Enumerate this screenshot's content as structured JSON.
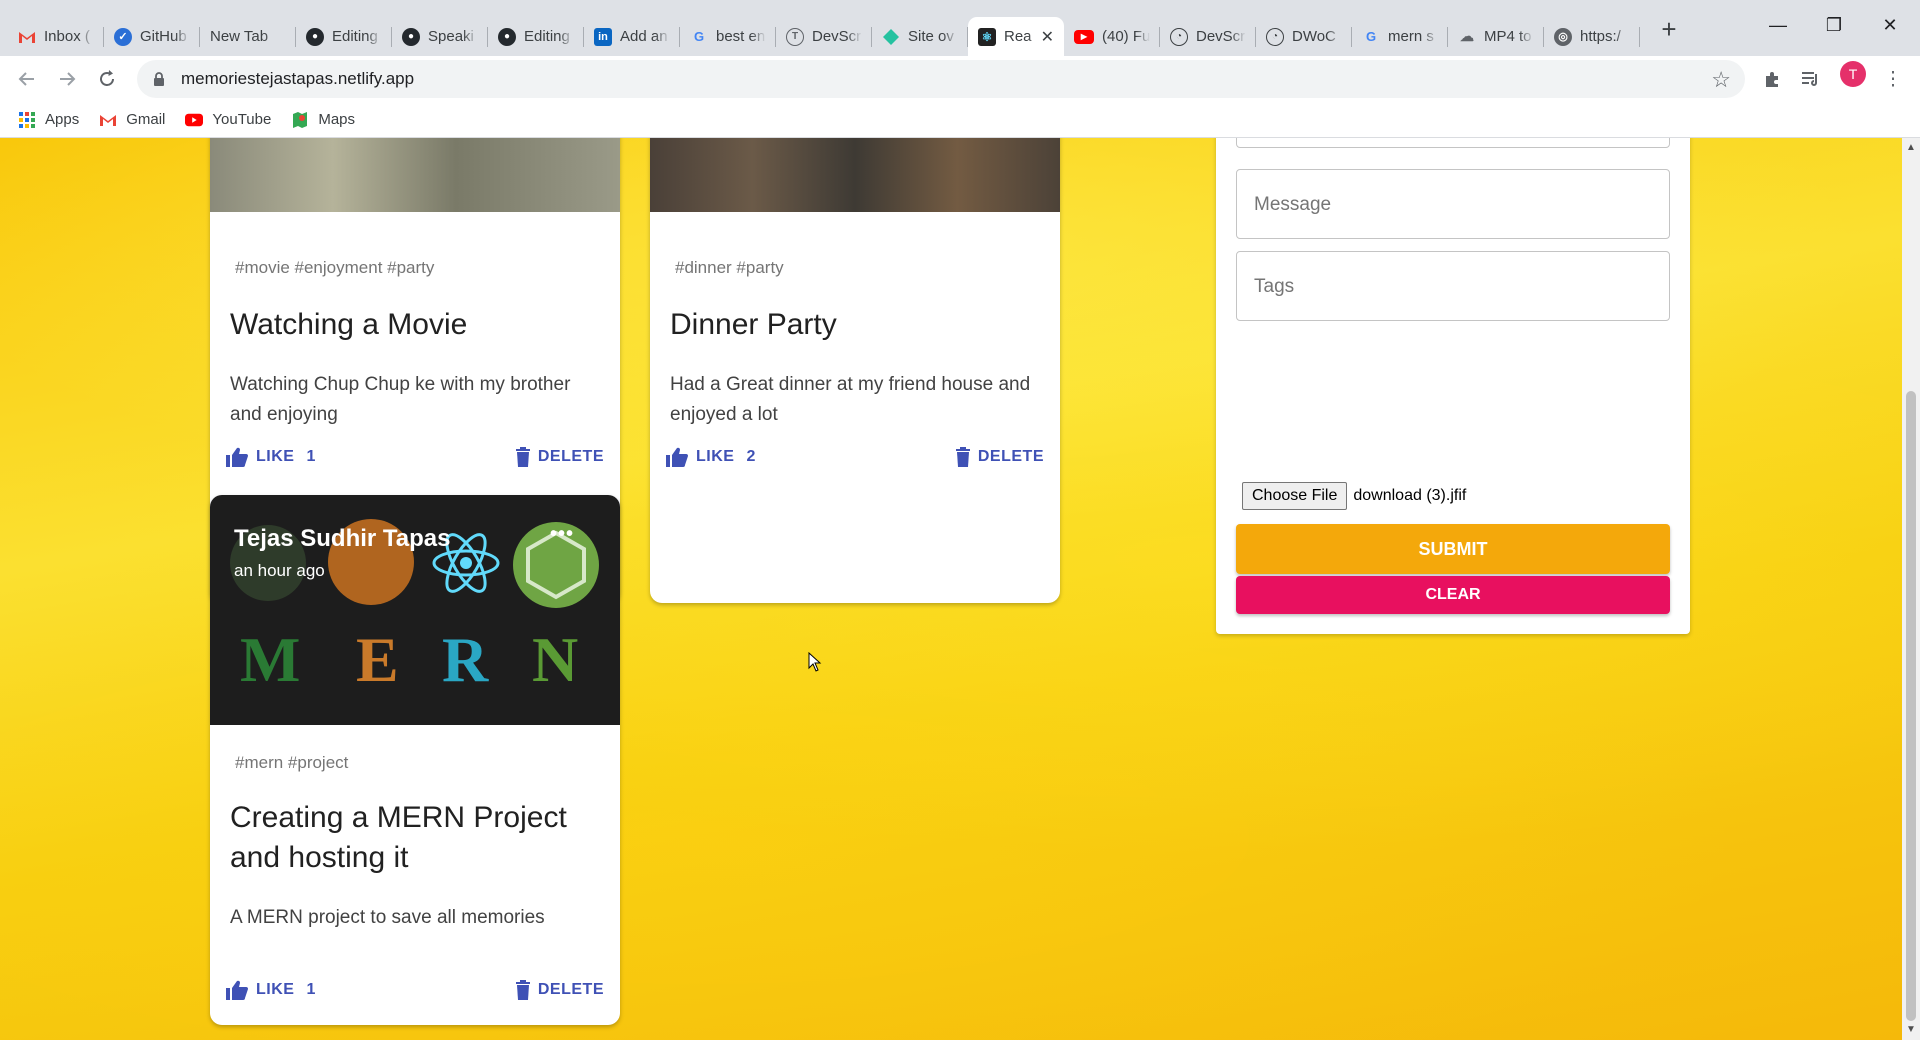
{
  "browser": {
    "tabs": [
      {
        "title": "Inbox (",
        "icon": "gmail-icon"
      },
      {
        "title": "GitHub",
        "icon": "github-icon"
      },
      {
        "title": "New Tab",
        "icon": ""
      },
      {
        "title": "Editing",
        "icon": "github-icon"
      },
      {
        "title": "Speaki",
        "icon": "github-icon"
      },
      {
        "title": "Editing",
        "icon": "github-icon"
      },
      {
        "title": "Add an",
        "icon": "linkedin-icon"
      },
      {
        "title": "best en",
        "icon": "google-icon"
      },
      {
        "title": "DevScr",
        "icon": "devscript-icon"
      },
      {
        "title": "Site ov",
        "icon": "netlify-icon"
      },
      {
        "title": "Rea",
        "icon": "react-icon"
      },
      {
        "title": "(40) Fu",
        "icon": "youtube-icon"
      },
      {
        "title": "DevScr",
        "icon": "devscript-icon"
      },
      {
        "title": "DWoC",
        "icon": "dwoc-icon"
      },
      {
        "title": "mern s",
        "icon": "google-icon"
      },
      {
        "title": "MP4 to",
        "icon": "cloud-icon"
      },
      {
        "title": "https:/",
        "icon": "globe-icon"
      }
    ],
    "active_tab_index": 10,
    "url": "memoriestejastapas.netlify.app",
    "profile_initial": "T",
    "bookmarks": [
      {
        "label": "Apps",
        "icon": "apps-grid-icon"
      },
      {
        "label": "Gmail",
        "icon": "gmail-icon"
      },
      {
        "label": "YouTube",
        "icon": "youtube-icon"
      },
      {
        "label": "Maps",
        "icon": "maps-icon"
      }
    ]
  },
  "posts": [
    {
      "tags": "#movie #enjoyment #party",
      "title": "Watching a Movie",
      "message": "Watching Chup Chup ke with my brother and enjoying",
      "like_label": "LIKE",
      "like_count": "1",
      "delete_label": "DELETE"
    },
    {
      "tags": "#dinner #party",
      "title": "Dinner Party",
      "message": "Had a Great dinner at my friend house and enjoyed a lot",
      "like_label": "LIKE",
      "like_count": "2",
      "delete_label": "DELETE"
    },
    {
      "author": "Tejas Sudhir Tapas",
      "time": "an hour ago",
      "more": "•••",
      "image_letters": [
        "M",
        "E",
        "R",
        "N"
      ],
      "tags": "#mern #project",
      "title": "Creating a MERN Project and hosting it",
      "message": "A MERN project to save all memories",
      "like_label": "LIKE",
      "like_count": "1",
      "delete_label": "DELETE"
    }
  ],
  "form": {
    "message_placeholder": "Message",
    "tags_placeholder": "Tags",
    "choose_file_label": "Choose File",
    "file_name": "download (3).jfif",
    "submit_label": "SUBMIT",
    "clear_label": "CLEAR"
  },
  "colors": {
    "accent": "#3f51b5",
    "submit": "#f4a80b",
    "clear": "#e8105f"
  }
}
